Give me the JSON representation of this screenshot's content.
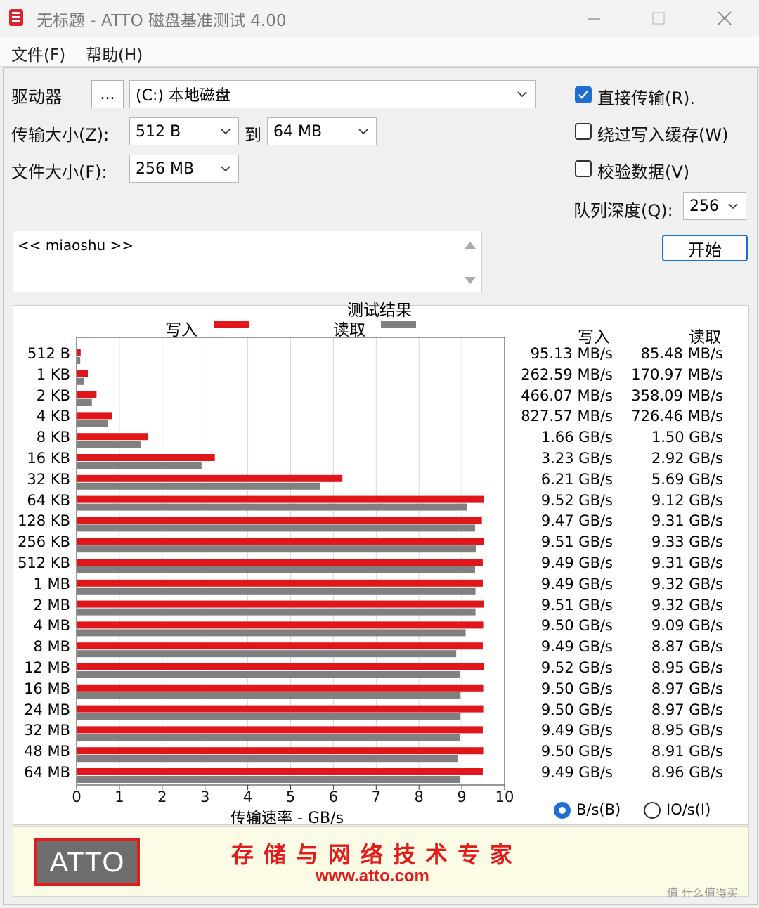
{
  "window": {
    "title": "无标题 - ATTO 磁盘基准测试 4.00",
    "minimize_icon": "minimize-icon",
    "maximize_icon": "maximize-icon",
    "close_icon": "close-icon"
  },
  "menu": {
    "file": "文件(F)",
    "help": "帮助(H)"
  },
  "settings": {
    "drive_label": "驱动器",
    "browse_label": "...",
    "drive_value": "(C:) 本地磁盘",
    "transfer_label": "传输大小(Z):",
    "transfer_from": "512 B",
    "to_label": "到",
    "transfer_to": "64 MB",
    "file_size_label": "文件大小(F):",
    "file_size": "256 MB",
    "direct_io_label": "直接传输(R).",
    "direct_io_checked": true,
    "bypass_cache_label": "绕过写入缓存(W)",
    "bypass_cache_checked": false,
    "verify_label": "校验数据(V)",
    "verify_checked": false,
    "queue_label": "队列深度(Q):",
    "queue_value": "256",
    "start_label": "开始",
    "description": "<< miaoshu >>"
  },
  "results": {
    "title": "测试结果",
    "write_legend": "写入",
    "read_legend": "读取",
    "write_header": "写入",
    "read_header": "读取",
    "unit_bs": "B/s(B)",
    "unit_ios": "IO/s(I)",
    "unit_selected": "B/s(B)",
    "write_values": [
      "95.13 MB/s",
      "262.59 MB/s",
      "466.07 MB/s",
      "827.57 MB/s",
      "1.66 GB/s",
      "3.23 GB/s",
      "6.21 GB/s",
      "9.52 GB/s",
      "9.47 GB/s",
      "9.51 GB/s",
      "9.49 GB/s",
      "9.49 GB/s",
      "9.51 GB/s",
      "9.50 GB/s",
      "9.49 GB/s",
      "9.52 GB/s",
      "9.50 GB/s",
      "9.50 GB/s",
      "9.49 GB/s",
      "9.50 GB/s",
      "9.49 GB/s"
    ],
    "read_values": [
      "85.48 MB/s",
      "170.97 MB/s",
      "358.09 MB/s",
      "726.46 MB/s",
      "1.50 GB/s",
      "2.92 GB/s",
      "5.69 GB/s",
      "9.12 GB/s",
      "9.31 GB/s",
      "9.33 GB/s",
      "9.31 GB/s",
      "9.32 GB/s",
      "9.32 GB/s",
      "9.09 GB/s",
      "8.87 GB/s",
      "8.95 GB/s",
      "8.97 GB/s",
      "8.97 GB/s",
      "8.95 GB/s",
      "8.91 GB/s",
      "8.96 GB/s"
    ]
  },
  "chart_data": {
    "type": "bar",
    "orientation": "horizontal",
    "title": "测试结果",
    "xlabel": "传输速率 - GB/s",
    "xlim": [
      0,
      10
    ],
    "xticks": [
      "0",
      "1",
      "2",
      "3",
      "4",
      "5",
      "6",
      "7",
      "8",
      "9",
      "10"
    ],
    "grid": true,
    "categories": [
      "512 B",
      "1 KB",
      "2 KB",
      "4 KB",
      "8 KB",
      "16 KB",
      "32 KB",
      "64 KB",
      "128 KB",
      "256 KB",
      "512 KB",
      "1 MB",
      "2 MB",
      "4 MB",
      "8 MB",
      "12 MB",
      "16 MB",
      "24 MB",
      "32 MB",
      "48 MB",
      "64 MB"
    ],
    "series": [
      {
        "name": "写入",
        "color": "#e0161b",
        "values": [
          0.09513,
          0.26259,
          0.46607,
          0.82757,
          1.66,
          3.23,
          6.21,
          9.52,
          9.47,
          9.51,
          9.49,
          9.49,
          9.51,
          9.5,
          9.49,
          9.52,
          9.5,
          9.5,
          9.49,
          9.5,
          9.49
        ]
      },
      {
        "name": "读取",
        "color": "#808080",
        "values": [
          0.08548,
          0.17097,
          0.35809,
          0.72646,
          1.5,
          2.92,
          5.69,
          9.12,
          9.31,
          9.33,
          9.31,
          9.32,
          9.32,
          9.09,
          8.87,
          8.95,
          8.97,
          8.97,
          8.95,
          8.91,
          8.96
        ]
      }
    ]
  },
  "banner": {
    "logo": "ATTO",
    "slogan": "存储与网络技术专家",
    "url": "www.atto.com",
    "watermark": "值 什么值得买"
  },
  "colors": {
    "accent": "#1f6fd0",
    "write": "#e0161b",
    "read": "#808080",
    "logo_red": "#e21b1b"
  }
}
